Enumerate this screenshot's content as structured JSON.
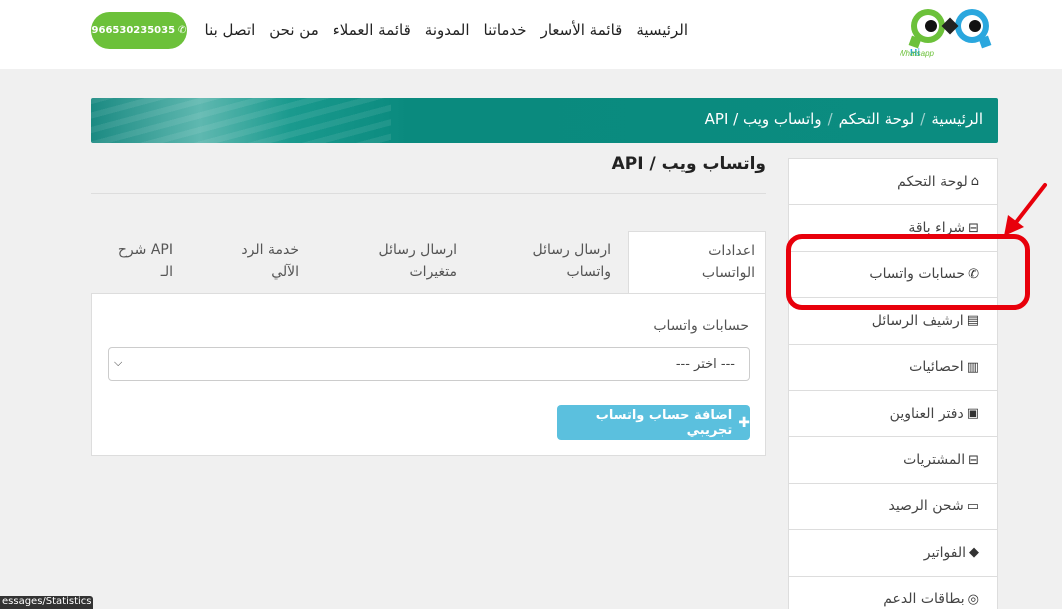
{
  "header": {
    "logo_text": "Hi Whatsapp",
    "nav": [
      "الرئيسية",
      "قائمة الأسعار",
      "خدماتنا",
      "المدونة",
      "قائمة العملاء",
      "من نحن",
      "اتصل بنا"
    ],
    "phone": "966530235035"
  },
  "breadcrumb": [
    "الرئيسية",
    "لوحة التحكم",
    "واتساب ويب / API"
  ],
  "page": {
    "title": "واتساب ويب / API",
    "tabs": [
      {
        "line1": "اعدادات",
        "line2": "الواتساب",
        "active": true
      },
      {
        "line1": "ارسال رسائل",
        "line2": "واتساب",
        "active": false
      },
      {
        "line1": "ارسال رسائل",
        "line2": "متغيرات",
        "active": false
      },
      {
        "line1": "خدمة الرد",
        "line2": "الآلي",
        "active": false
      },
      {
        "line1": "API شرح",
        "line2": "الـ",
        "active": false
      }
    ],
    "field_label": "حسابات واتساب",
    "select_value": "--- اختر ---",
    "add_button": "اضافة حساب واتساب تجريبي"
  },
  "sidebar": {
    "items": [
      {
        "label": "لوحة التحكم",
        "icon": "home-icon"
      },
      {
        "label": "شراء باقة",
        "icon": "basket-icon"
      },
      {
        "label": "حسابات واتساب",
        "icon": "whatsapp-icon"
      },
      {
        "label": "ارشيف الرسائل",
        "icon": "archive-icon"
      },
      {
        "label": "احصائيات",
        "icon": "bar-chart-icon"
      },
      {
        "label": "دفتر العناوين",
        "icon": "address-book-icon"
      },
      {
        "label": "المشتريات",
        "icon": "basket-icon"
      },
      {
        "label": "شحن الرصيد",
        "icon": "credit-card-icon"
      },
      {
        "label": "الفواتير",
        "icon": "tags-icon"
      },
      {
        "label": "بطاقات الدعم",
        "icon": "life-ring-icon"
      }
    ]
  },
  "status_tooltip": "essages/Statistics",
  "colors": {
    "accent_green": "#6cc13a",
    "breadcrumb_teal": "#0b8c80",
    "button_info": "#5bc0de",
    "annotation_red": "#e8000b"
  }
}
